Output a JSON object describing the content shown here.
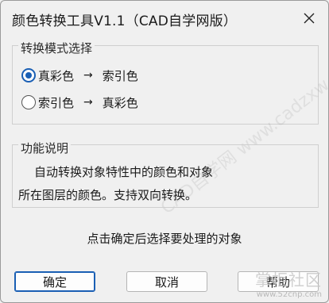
{
  "window": {
    "title": "颜色转换工具V1.1（CAD自学网版）",
    "close_icon": "close-icon"
  },
  "mode_group": {
    "legend": "转换模式选择",
    "options": [
      {
        "from": "真彩色",
        "arrow": "→",
        "to": "索引色",
        "selected": true
      },
      {
        "from": "索引色",
        "arrow": "→",
        "to": "真彩色",
        "selected": false
      }
    ]
  },
  "info_group": {
    "legend": "功能说明",
    "line1": "自动转换对象特性中的颜色和对象",
    "line2": "所在图层的颜色。支持双向转换。"
  },
  "hint": "点击确定后选择要处理的对象",
  "buttons": {
    "ok": "确定",
    "cancel": "取消",
    "help": "帮助"
  },
  "watermark": {
    "diagonal": "CAD自学网 www.cadzxw.com",
    "logo": "掌柜社区",
    "url": "www.52cnp.com"
  },
  "colors": {
    "accent": "#1a5fb4",
    "background": "#f0f0f0"
  }
}
